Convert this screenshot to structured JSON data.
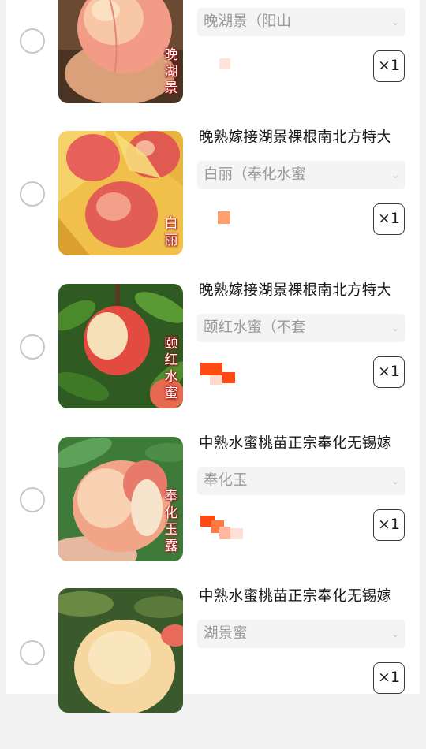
{
  "colors": {
    "price": "#ff4a14",
    "price_light": "#ffb8a0",
    "border_radio": "#c7c7c7"
  },
  "items": [
    {
      "title": "",
      "variant": "晚湖景（阳山",
      "qty": "×1",
      "thumb_label": "晚湖景"
    },
    {
      "title": "晚熟嫁接湖景裸根南北方特大",
      "variant": "白丽（奉化水蜜",
      "qty": "×1",
      "thumb_label": "白丽"
    },
    {
      "title": "晚熟嫁接湖景裸根南北方特大",
      "variant": "颐红水蜜（不套",
      "qty": "×1",
      "thumb_label": "颐红水蜜"
    },
    {
      "title": "中熟水蜜桃苗正宗奉化无锡嫁",
      "variant": "奉化玉",
      "qty": "×1",
      "thumb_label": "奉化玉露"
    },
    {
      "title": "中熟水蜜桃苗正宗奉化无锡嫁",
      "variant": "湖景蜜",
      "qty": "×1",
      "thumb_label": ""
    }
  ]
}
